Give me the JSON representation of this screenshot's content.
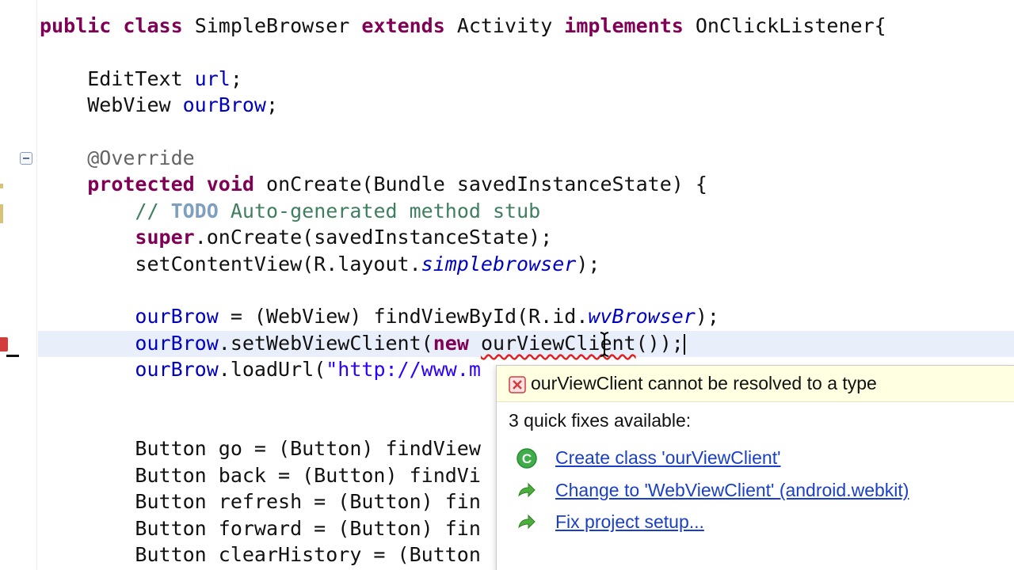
{
  "code_lines": [
    [
      {
        "t": "public",
        "c": "kw"
      },
      {
        "t": " "
      },
      {
        "t": "class",
        "c": "kw"
      },
      {
        "t": " SimpleBrowser "
      },
      {
        "t": "extends",
        "c": "kw"
      },
      {
        "t": " Activity "
      },
      {
        "t": "implements",
        "c": "kw"
      },
      {
        "t": " OnClickListener{"
      }
    ],
    [],
    [
      {
        "t": "    EditText "
      },
      {
        "t": "url",
        "c": "fld"
      },
      {
        "t": ";"
      }
    ],
    [
      {
        "t": "    WebView "
      },
      {
        "t": "ourBrow",
        "c": "fld"
      },
      {
        "t": ";"
      }
    ],
    [],
    [
      {
        "t": "    "
      },
      {
        "t": "@Override",
        "c": "ann"
      }
    ],
    [
      {
        "t": "    "
      },
      {
        "t": "protected",
        "c": "kw"
      },
      {
        "t": " "
      },
      {
        "t": "void",
        "c": "kw"
      },
      {
        "t": " onCreate(Bundle savedInstanceState) {"
      }
    ],
    [
      {
        "t": "        "
      },
      {
        "t": "// ",
        "c": "cmt"
      },
      {
        "t": "TODO",
        "c": "todo"
      },
      {
        "t": " Auto-generated method stub",
        "c": "cmt"
      }
    ],
    [
      {
        "t": "        "
      },
      {
        "t": "super",
        "c": "kw"
      },
      {
        "t": ".onCreate(savedInstanceState);"
      }
    ],
    [
      {
        "t": "        setContentView(R.layout."
      },
      {
        "t": "simplebrowser",
        "c": "ital"
      },
      {
        "t": ");"
      }
    ],
    [],
    [
      {
        "t": "        "
      },
      {
        "t": "ourBrow",
        "c": "fld"
      },
      {
        "t": " = (WebView) findViewById(R.id."
      },
      {
        "t": "wvBrowser",
        "c": "ital"
      },
      {
        "t": ");"
      }
    ],
    [
      {
        "t": "        "
      },
      {
        "t": "ourBrow",
        "c": "fld"
      },
      {
        "t": ".setWebViewClient("
      },
      {
        "t": "new",
        "c": "kw"
      },
      {
        "t": " "
      },
      {
        "t": "ourViewClient",
        "c": "err"
      },
      {
        "t": "());"
      }
    ],
    [
      {
        "t": "        "
      },
      {
        "t": "ourBrow",
        "c": "fld"
      },
      {
        "t": ".loadUrl("
      },
      {
        "t": "\"http://www.m",
        "c": "str"
      }
    ],
    [],
    [],
    [
      {
        "t": "        Button go = (Button) findView"
      }
    ],
    [
      {
        "t": "        Button back = (Button) findVi"
      }
    ],
    [
      {
        "t": "        Button refresh = (Button) fin"
      }
    ],
    [
      {
        "t": "        Button forward = (Button) fin"
      }
    ],
    [
      {
        "t": "        Button clearHistory = (Button"
      }
    ]
  ],
  "quick_fix": {
    "message": "ourViewClient cannot be resolved to a type",
    "fixes_title": "3 quick fixes available:",
    "fixes": [
      {
        "label": "Create class 'ourViewClient'",
        "icon": "create-class-icon"
      },
      {
        "label": "Change to 'WebViewClient' (android.webkit)",
        "icon": "change-type-icon"
      },
      {
        "label": "Fix project setup...",
        "icon": "fix-setup-icon"
      }
    ]
  },
  "colors": {
    "keyword": "#7f0055",
    "field": "#0000c0",
    "comment": "#3f7f5f",
    "string": "#2a00ff",
    "annotation": "#646464",
    "link": "#1a3fc7",
    "popup_header_bg": "#ffffe1",
    "error": "#d33c3c"
  }
}
